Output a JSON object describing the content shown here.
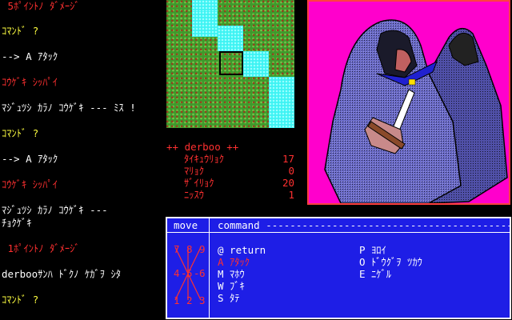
{
  "log": [
    {
      "text": " 5ﾎﾟｲﾝﾄﾉ ﾀﾞﾒｰｼﾞ",
      "color": "#ff3030"
    },
    {
      "text": "ｺﾏﾝﾄﾞ ?",
      "color": "#ffff40"
    },
    {
      "text": "--> A ｱﾀｯｸ",
      "color": "#ffffff"
    },
    {
      "text": "ｺｳｹﾞｷ ｼｯﾊﾟｲ",
      "color": "#ff3030"
    },
    {
      "text": "ﾏｼﾞｭﾂｼ ｶﾗﾉ ｺｳｹﾞｷ --- ﾐｽ !",
      "color": "#ffffff"
    },
    {
      "text": "ｺﾏﾝﾄﾞ ?",
      "color": "#ffff40"
    },
    {
      "text": "--> A ｱﾀｯｸ",
      "color": "#ffffff"
    },
    {
      "text": "ｺｳｹﾞｷ ｼｯﾊﾟｲ",
      "color": "#ff3030"
    },
    {
      "text": "ﾏｼﾞｭﾂｼ ｶﾗﾉ ｺｳｹﾞｷ ---",
      "color": "#ffffff"
    },
    {
      "text": "ﾁｮｸｹﾞｷ",
      "color": "#ffffff"
    },
    {
      "text": " 1ﾎﾟｲﾝﾄﾉ ﾀﾞﾒｰｼﾞ",
      "color": "#ff3030"
    },
    {
      "text": "derbooｻﾝﾊ ﾄﾞｸﾉ ｹｶﾞｦ ｼﾀ",
      "color": "#ffffff"
    },
    {
      "text": "ｺﾏﾝﾄﾞ ?",
      "color": "#ffff40"
    }
  ],
  "status": {
    "name": "++ derboo ++",
    "stats": [
      {
        "label": "ﾀｲｷｭｳﾘｮｸ",
        "value": "17"
      },
      {
        "label": "ﾏﾘｮｸ",
        "value": "0"
      },
      {
        "label": "ｻﾞｲﾘｮｸ",
        "value": "20"
      },
      {
        "label": "ﾆｯｽｳ",
        "value": "1"
      }
    ]
  },
  "panel": {
    "move_header": "move",
    "command_header": "command ------------------------------------------",
    "move_digits": {
      "n7": "7",
      "n8": "8",
      "n9": "9",
      "n4": "4",
      "n5": "5",
      "n6": "6",
      "n1": "1",
      "n2": "2",
      "n3": "3"
    },
    "commands_left": [
      {
        "text": "@ return",
        "color": "#ffffff"
      },
      {
        "text": "A ｱﾀｯｸ",
        "color": "#ff3030"
      },
      {
        "text": "M ﾏﾎｳ",
        "color": "#ffffff"
      },
      {
        "text": "W ﾌﾞｷ",
        "color": "#ffffff"
      },
      {
        "text": "S ﾀﾃ",
        "color": "#ffffff"
      }
    ],
    "commands_right": [
      {
        "text": "P ﾖﾛｲ",
        "color": "#ffffff"
      },
      {
        "text": "O ﾄﾞｳｸﾞｦ ﾂｶｳ",
        "color": "#ffffff"
      },
      {
        "text": "E ﾆｹﾞﾙ",
        "color": "#ffffff"
      }
    ]
  },
  "colors": {
    "red": "#ff3030",
    "yellow": "#ffff40",
    "white": "#ffffff",
    "panel": "#1e1ee6",
    "portrait_bg": "#ff00cc",
    "grass": "#3e9a2c",
    "water": "#3cf3f3"
  }
}
